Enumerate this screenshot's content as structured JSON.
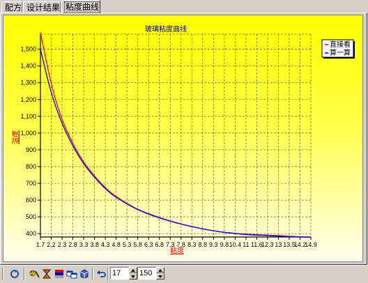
{
  "tabs": [
    {
      "label": "配方",
      "active": false
    },
    {
      "label": "设计结果",
      "active": false
    },
    {
      "label": "粘度曲线",
      "active": true
    }
  ],
  "chart_data": {
    "type": "line",
    "title": "玻璃粘度曲线",
    "xlabel": "粘度",
    "ylabel": "温度",
    "x_ticks": [
      "1.7",
      "2.2",
      "2.3",
      "2.8",
      "3.3",
      "3.8",
      "4.3",
      "4.8",
      "5.3",
      "5.8",
      "6.3",
      "6.8",
      "7.3",
      "7.8",
      "8.3",
      "8.8",
      "9.3",
      "9.8",
      "10.4",
      "11",
      "11.6",
      "12.3",
      "13",
      "13.5",
      "14.2",
      "14.9"
    ],
    "y_ticks": [
      "400",
      "500",
      "600",
      "700",
      "800",
      "900",
      "1,000",
      "1,100",
      "1,200",
      "1,300",
      "1,400",
      "1,500"
    ],
    "xlim": [
      1.7,
      14.9
    ],
    "ylim": [
      380,
      1590
    ],
    "grid": true,
    "legend_position": "top-right",
    "series": [
      {
        "name": "直接看",
        "color": "#ff0000",
        "x": [
          1.7,
          2.2,
          2.7,
          3.3,
          3.8,
          4.3,
          4.8,
          5.3,
          6.3,
          7.3,
          8.3,
          9.3,
          10.4,
          11.6,
          13.0,
          14.2,
          14.9
        ],
        "y": [
          1600,
          1310,
          1100,
          935,
          830,
          750,
          683,
          630,
          555,
          505,
          467,
          437,
          413,
          398,
          390,
          382,
          380
        ]
      },
      {
        "name": "算一算",
        "color": "#0000ff",
        "x": [
          1.7,
          2.2,
          2.7,
          3.3,
          3.8,
          4.3,
          4.8,
          5.3,
          6.3,
          7.3,
          8.3,
          9.3,
          10.4,
          11.6,
          13.0,
          14.2,
          14.9
        ],
        "y": [
          1500,
          1255,
          1075,
          920,
          820,
          742,
          677,
          625,
          552,
          502,
          465,
          436,
          412,
          396,
          387,
          380,
          378
        ]
      }
    ]
  },
  "toolbar": {
    "spin1_value": "17",
    "spin2_value": "150",
    "icons": [
      "refresh-icon",
      "palette-icon",
      "hourglass-icon",
      "color-bars-icon",
      "window-tile-icon",
      "cube-icon",
      "undo-icon"
    ]
  }
}
